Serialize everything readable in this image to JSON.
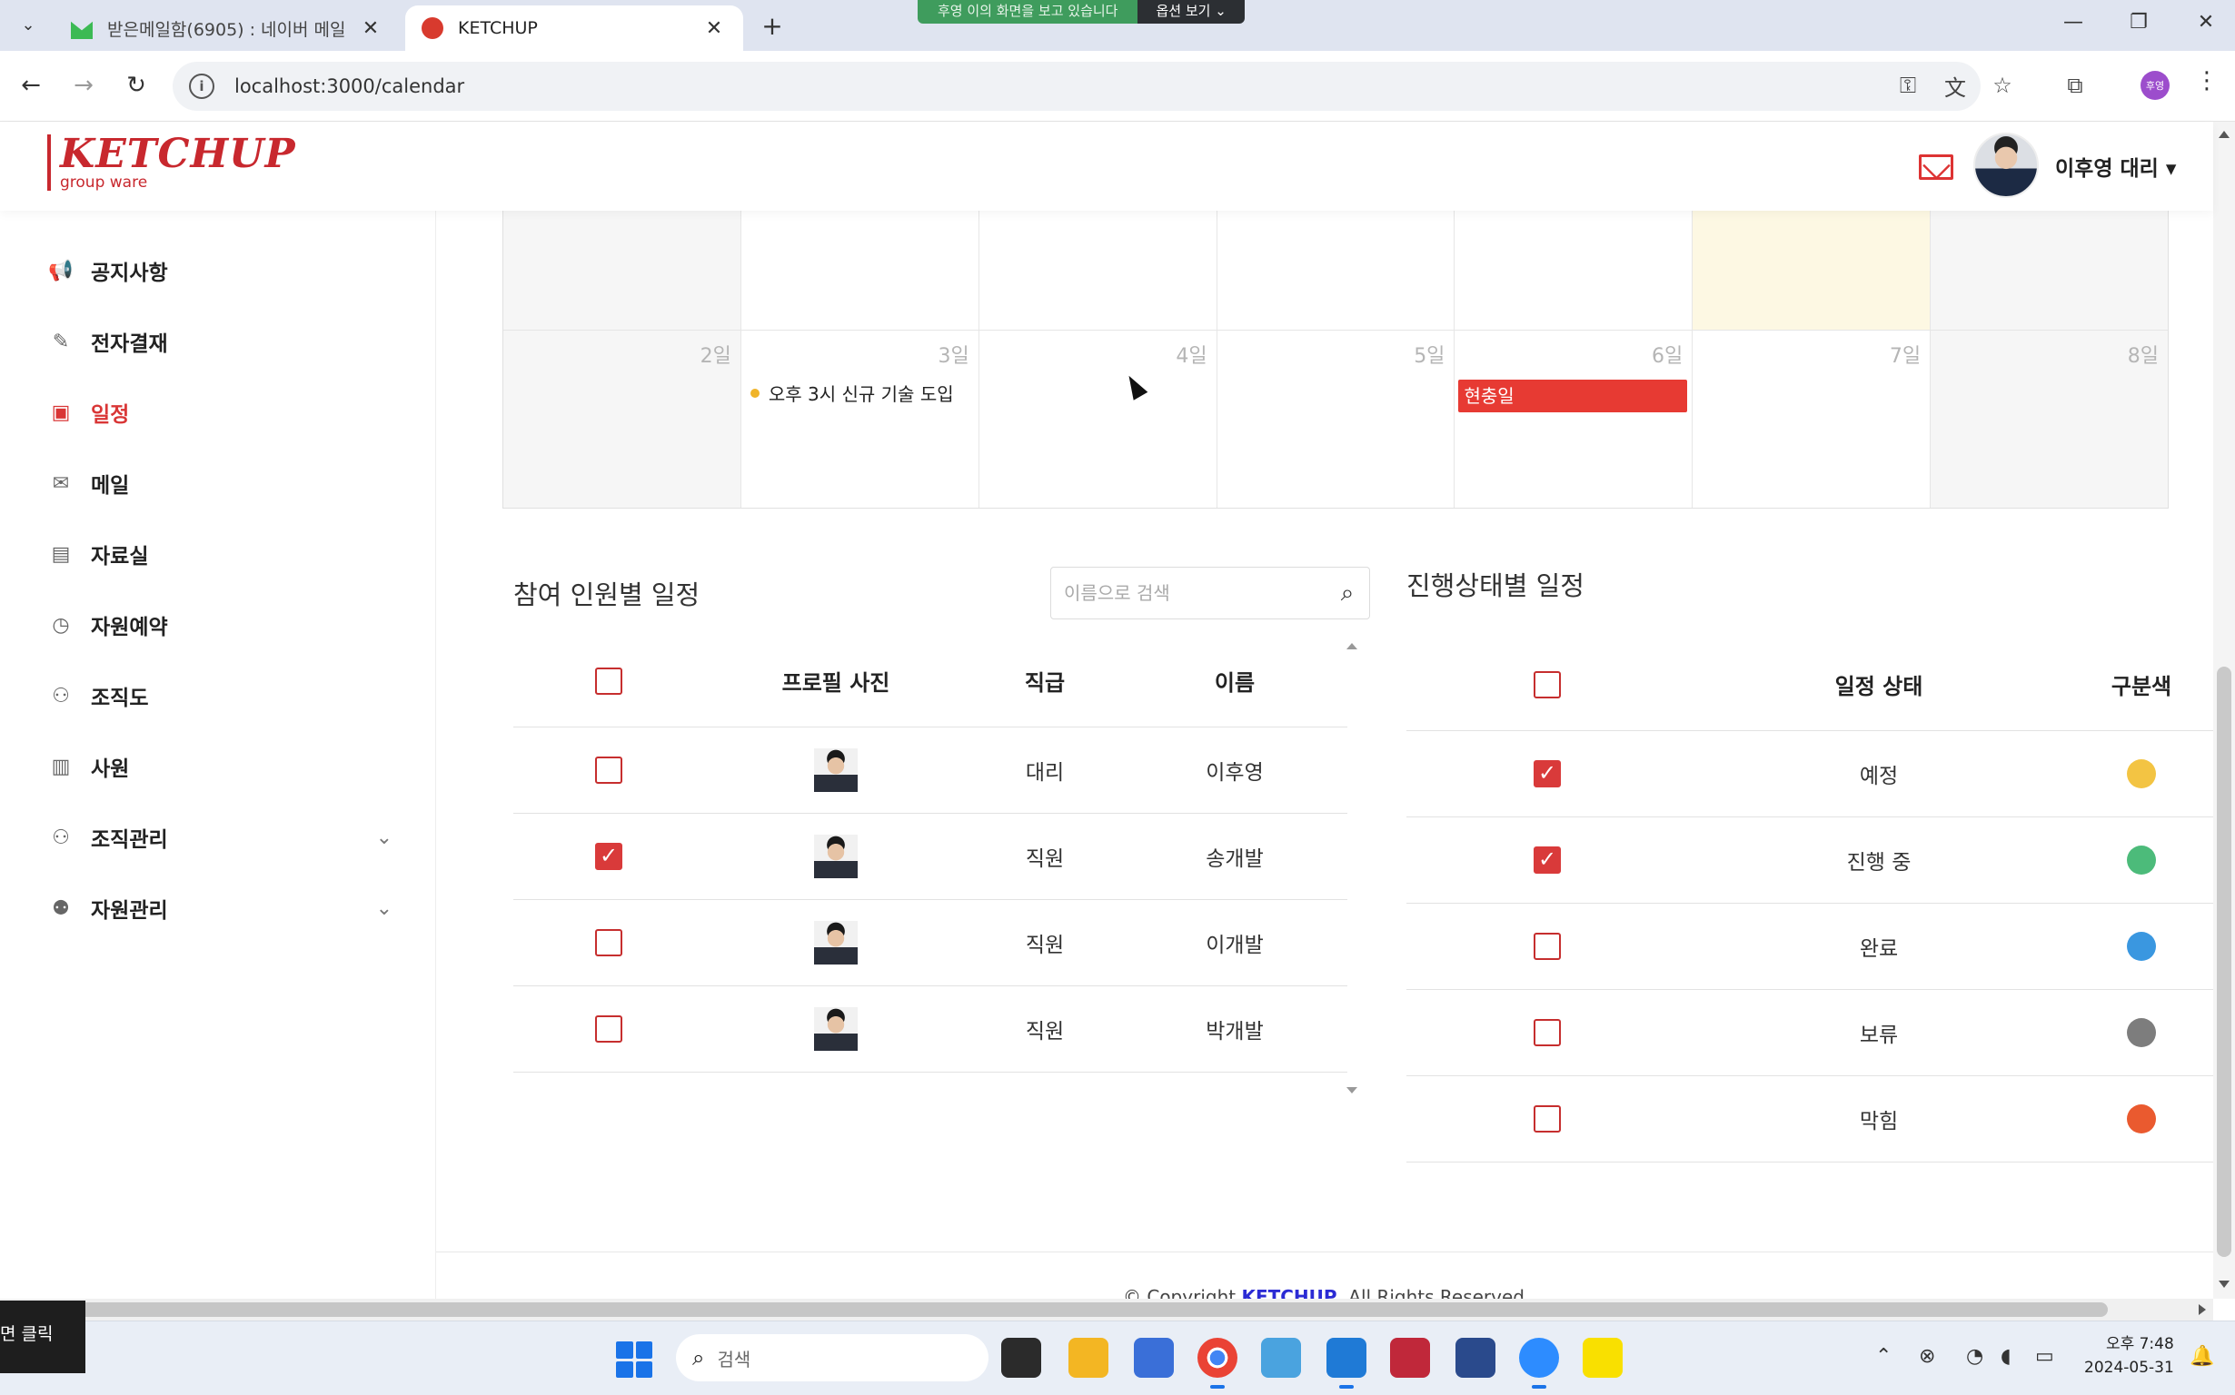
{
  "browser": {
    "tabs": [
      {
        "title": "받은메일함(6905) : 네이버 메일",
        "close": "✕"
      },
      {
        "title": "KETCHUP",
        "close": "✕"
      }
    ],
    "new_tab": "+",
    "share_banner": {
      "message": "후영 이의 화면을 보고 있습니다",
      "options": "옵션 보기"
    },
    "url": "localhost:3000/calendar",
    "profile_initial": "후영",
    "window_controls": {
      "minimize": "—",
      "restore": "❐",
      "close": "✕"
    }
  },
  "app_header": {
    "logo": "KETCHUP",
    "logo_sub": "group ware",
    "user_name": "이후영 대리 ▾"
  },
  "sidebar": {
    "items": [
      {
        "label": "공지사항",
        "icon": "megaphone-icon"
      },
      {
        "label": "전자결재",
        "icon": "edit-icon"
      },
      {
        "label": "일정",
        "icon": "calendar-icon",
        "active": true
      },
      {
        "label": "메일",
        "icon": "mail-icon"
      },
      {
        "label": "자료실",
        "icon": "document-icon"
      },
      {
        "label": "자원예약",
        "icon": "clock-icon"
      },
      {
        "label": "조직도",
        "icon": "org-chart-icon"
      },
      {
        "label": "사원",
        "icon": "badge-icon"
      },
      {
        "label": "조직관리",
        "icon": "org-chart-icon",
        "expandable": true
      },
      {
        "label": "자원관리",
        "icon": "people-icon",
        "expandable": true
      }
    ]
  },
  "calendar": {
    "week": [
      {
        "day": "2일"
      },
      {
        "day": "3일"
      },
      {
        "day": "4일"
      },
      {
        "day": "5일"
      },
      {
        "day": "6일"
      },
      {
        "day": "7일"
      },
      {
        "day": "8일"
      }
    ],
    "events": {
      "dot_event": "오후 3시 신규 기술 도입",
      "holiday": "현충일"
    }
  },
  "participants": {
    "title": "참여 인원별 일정",
    "search_placeholder": "이름으로 검색",
    "columns": [
      "프로필 사진",
      "직급",
      "이름"
    ],
    "rows": [
      {
        "rank": "대리",
        "name": "이후영",
        "checked": false
      },
      {
        "rank": "직원",
        "name": "송개발",
        "checked": true
      },
      {
        "rank": "직원",
        "name": "이개발",
        "checked": false
      },
      {
        "rank": "직원",
        "name": "박개발",
        "checked": false
      }
    ]
  },
  "status": {
    "title": "진행상태별 일정",
    "columns": [
      "일정 상태",
      "구분색"
    ],
    "rows": [
      {
        "label": "예정",
        "checked": true,
        "color": "#f3c443"
      },
      {
        "label": "진행 중",
        "checked": true,
        "color": "#4cbb7a"
      },
      {
        "label": "완료",
        "checked": false,
        "color": "#3a97e0"
      },
      {
        "label": "보류",
        "checked": false,
        "color": "#7d7d7d"
      },
      {
        "label": "막힘",
        "checked": false,
        "color": "#ea5a2f"
      }
    ]
  },
  "footer": {
    "prefix": "© Copyright",
    "brand": "KETCHUP",
    "suffix": "All Rights Reserved"
  },
  "overlay_tip": "면 클릭",
  "taskbar": {
    "search_placeholder": "검색",
    "clock_time": "오후 7:48",
    "clock_date": "2024-05-31"
  }
}
